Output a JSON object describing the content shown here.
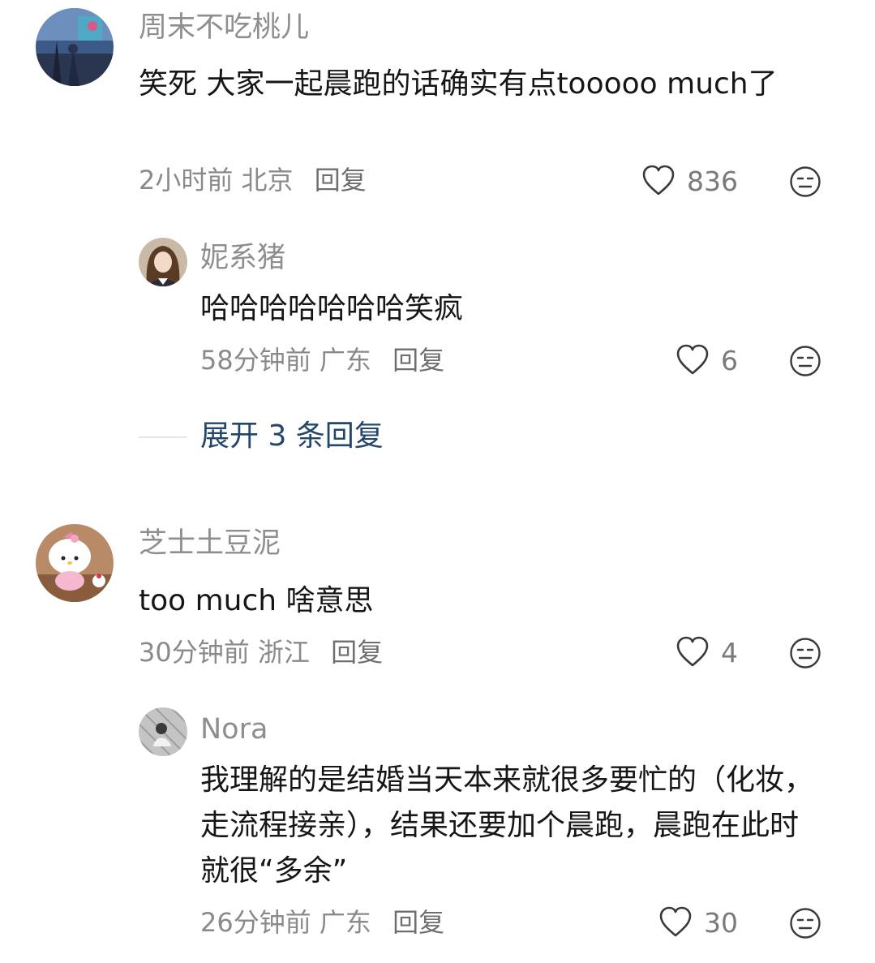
{
  "comments": [
    {
      "username": "周末不吃桃儿",
      "content": "笑死 大家一起晨跑的话确实有点tooooo much了",
      "time": "2小时前",
      "location": "北京",
      "reply_label": "回复",
      "likes": "836",
      "replies": [
        {
          "username": "妮系猪",
          "content": "哈哈哈哈哈哈哈笑疯",
          "time": "58分钟前",
          "location": "广东",
          "reply_label": "回复",
          "likes": "6"
        }
      ],
      "expand_label": "展开 3 条回复"
    },
    {
      "username": "芝士土豆泥",
      "content": "too much 啥意思",
      "time": "30分钟前",
      "location": "浙江",
      "reply_label": "回复",
      "likes": "4",
      "replies": [
        {
          "username": "Nora",
          "content": "我理解的是结婚当天本来就很多要忙的（化妆，走流程接亲），结果还要加个晨跑，晨跑在此时就很“多余”",
          "time": "26分钟前",
          "location": "广东",
          "reply_label": "回复",
          "likes": "30"
        }
      ]
    }
  ],
  "colors": {
    "username": "#8e8e8e",
    "content": "#161616",
    "meta": "#8a8a8a",
    "expand_link": "#23466b"
  },
  "icons": {
    "like": "heart-outline-icon",
    "dislike": "frown-face-icon"
  }
}
